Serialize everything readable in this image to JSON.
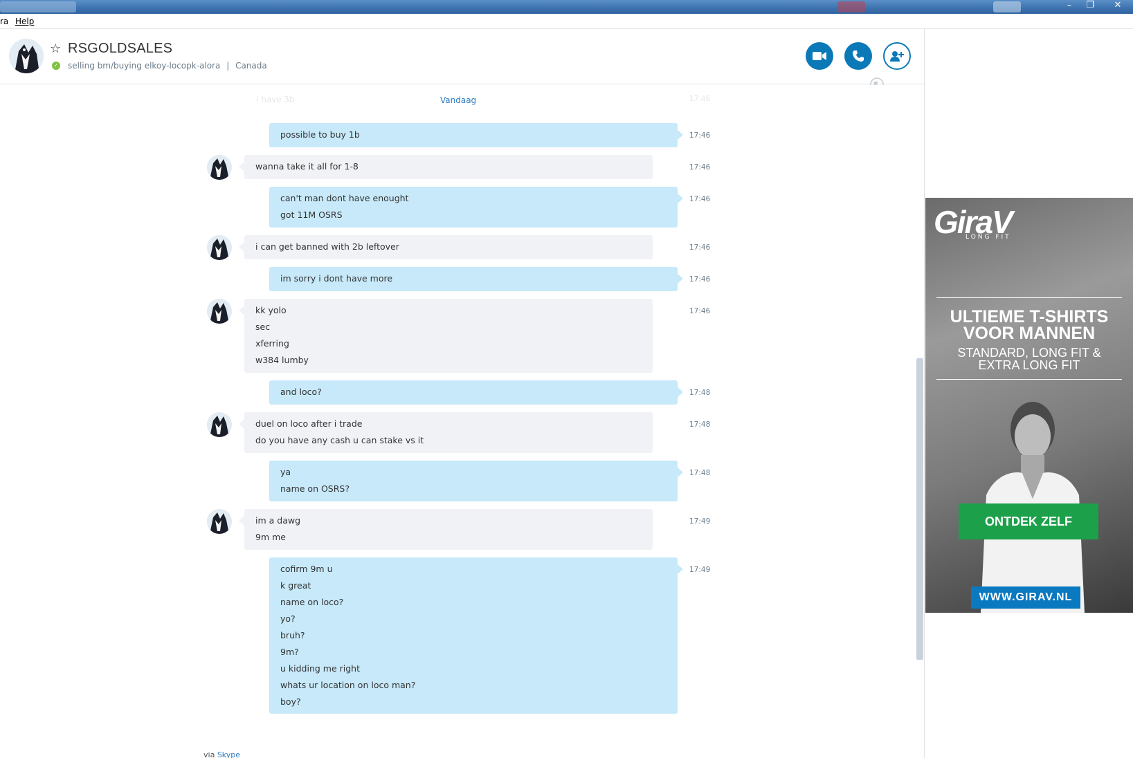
{
  "menu": {
    "left_fragment": "ra",
    "help": "Help"
  },
  "header": {
    "contact_name": "RSGOLDSALES",
    "mood": "selling bm/buying elkoy-locopk-alora",
    "separator": "|",
    "location": "Canada"
  },
  "conversation": {
    "date_separator": "Vandaag",
    "ghost_text": "i have 3b",
    "ghost_time": "17:46",
    "messages": [
      {
        "dir": "out",
        "time": "17:46",
        "lines": [
          "possible to buy 1b"
        ]
      },
      {
        "dir": "in",
        "time": "17:46",
        "lines": [
          "wanna take it all for 1-8"
        ]
      },
      {
        "dir": "out",
        "time": "17:46",
        "lines": [
          "can't man dont have enought",
          "got 11M OSRS"
        ]
      },
      {
        "dir": "in",
        "time": "17:46",
        "lines": [
          "i can get banned with 2b leftover"
        ]
      },
      {
        "dir": "out",
        "time": "17:46",
        "lines": [
          "im sorry i dont have more"
        ]
      },
      {
        "dir": "in",
        "time": "17:46",
        "lines": [
          "kk yolo",
          "sec",
          "xferring",
          "w384 lumby"
        ]
      },
      {
        "dir": "out",
        "time": "17:48",
        "lines": [
          "and loco?"
        ]
      },
      {
        "dir": "in",
        "time": "17:48",
        "lines": [
          "duel on loco after i trade",
          "do you have any cash u can stake vs it"
        ]
      },
      {
        "dir": "out",
        "time": "17:48",
        "lines": [
          "ya",
          "name on OSRS?"
        ]
      },
      {
        "dir": "in",
        "time": "17:49",
        "lines": [
          "im a dawg",
          "9m me"
        ]
      },
      {
        "dir": "out",
        "time": "17:49",
        "lines": [
          "cofirm 9m u",
          "k great",
          "name on loco?",
          "yo?",
          "bruh?",
          "9m?",
          "u kidding me right",
          "whats ur location on loco man?",
          "boy?"
        ]
      }
    ],
    "via_prefix": "via",
    "via_link": "Skype"
  },
  "ad": {
    "logo": "GiraV",
    "tagline": "LONG FIT",
    "headline1": "ULTIEME T-SHIRTS",
    "headline2": "VOOR MANNEN",
    "sub1": "STANDARD, LONG FIT &",
    "sub2": "EXTRA LONG FIT",
    "cta": "ONTDEK ZELF",
    "url": "WWW.GIRAV.NL",
    "colors": {
      "cta": "#1ca04a",
      "url": "#0a79c0"
    }
  },
  "theme": {
    "accent": "#0b78b8",
    "out_bubble": "#c7e9fa",
    "in_bubble": "#f0f2f5",
    "presence": "#7dc242"
  }
}
